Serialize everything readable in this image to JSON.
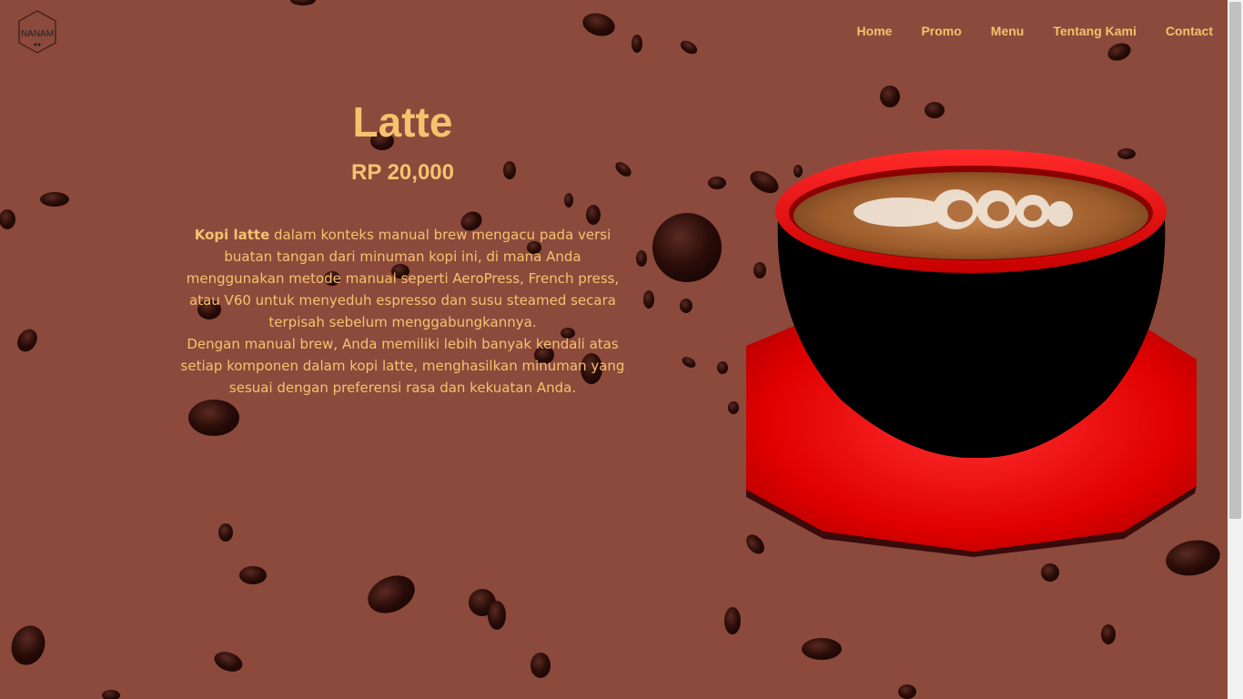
{
  "brand": {
    "logo_text": "NANAM"
  },
  "nav": {
    "items": [
      {
        "label": "Home"
      },
      {
        "label": "Promo"
      },
      {
        "label": "Menu"
      },
      {
        "label": "Tentang Kami"
      },
      {
        "label": "Contact"
      }
    ]
  },
  "product": {
    "name": "Latte",
    "price": "RP 20,000",
    "desc_bold": "Kopi latte",
    "desc_p1": " dalam konteks manual brew mengacu pada versi buatan tangan dari minuman kopi ini, di mana Anda menggunakan metode manual seperti AeroPress, French press, atau V60 untuk menyeduh espresso dan susu steamed secara terpisah sebelum menggabungkannya.",
    "desc_p2": "Dengan manual brew, Anda memiliki lebih banyak kendali atas setiap komponen dalam kopi latte, menghasilkan minuman yang sesuai dengan preferensi rasa dan kekuatan Anda."
  },
  "colors": {
    "background": "#8b4a3c",
    "text_accent": "#f7c26e",
    "cup_red": "#e00000",
    "cup_black": "#000000",
    "bean": "#2a0c08"
  },
  "icons": {
    "logo": "hexagon-logo-icon",
    "decor": "coffee-bean-icon",
    "image": "latte-cup-icon"
  }
}
